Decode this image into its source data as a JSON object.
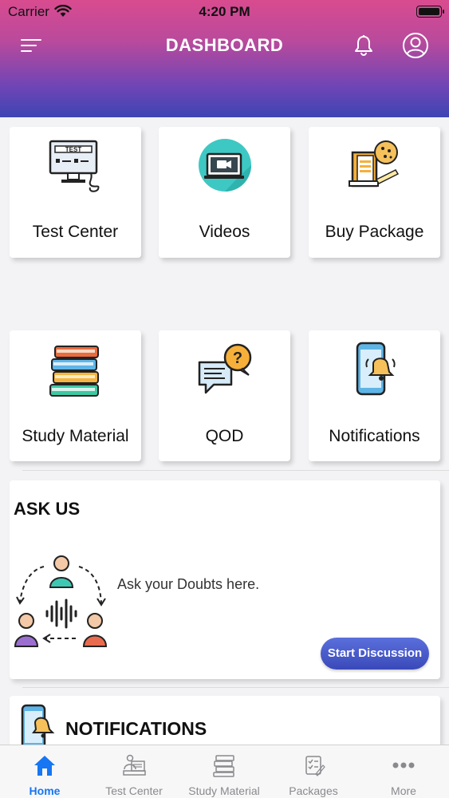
{
  "status_bar": {
    "carrier": "Carrier",
    "time": "4:20 PM"
  },
  "header": {
    "title": "DASHBOARD"
  },
  "tiles": [
    {
      "label": "Test Center",
      "icon": "test-monitor-icon"
    },
    {
      "label": "Videos",
      "icon": "video-player-icon"
    },
    {
      "label": "Buy Package",
      "icon": "book-package-icon"
    },
    {
      "label": "Study Material",
      "icon": "books-stack-icon"
    },
    {
      "label": "QOD",
      "icon": "question-chat-icon"
    },
    {
      "label": "Notifications",
      "icon": "phone-bell-icon"
    }
  ],
  "ask_us": {
    "title": "ASK US",
    "text": "Ask your Doubts here.",
    "button": "Start Discussion",
    "icon": "discussion-group-icon"
  },
  "notifications_section": {
    "title": "NOTIFICATIONS",
    "icon": "phone-bell-icon"
  },
  "tabbar": {
    "active_index": 0,
    "active_color": "#1676f3",
    "items": [
      {
        "label": "Home",
        "icon": "home-icon"
      },
      {
        "label": "Test Center",
        "icon": "test-center-icon"
      },
      {
        "label": "Study Material",
        "icon": "study-material-icon"
      },
      {
        "label": "Packages",
        "icon": "packages-icon"
      },
      {
        "label": "More",
        "icon": "more-dots-icon"
      }
    ]
  },
  "colors": {
    "header_gradient_top": "#d94b8f",
    "header_gradient_bottom": "#3d45b3",
    "button_blue": "#3a49b9"
  }
}
